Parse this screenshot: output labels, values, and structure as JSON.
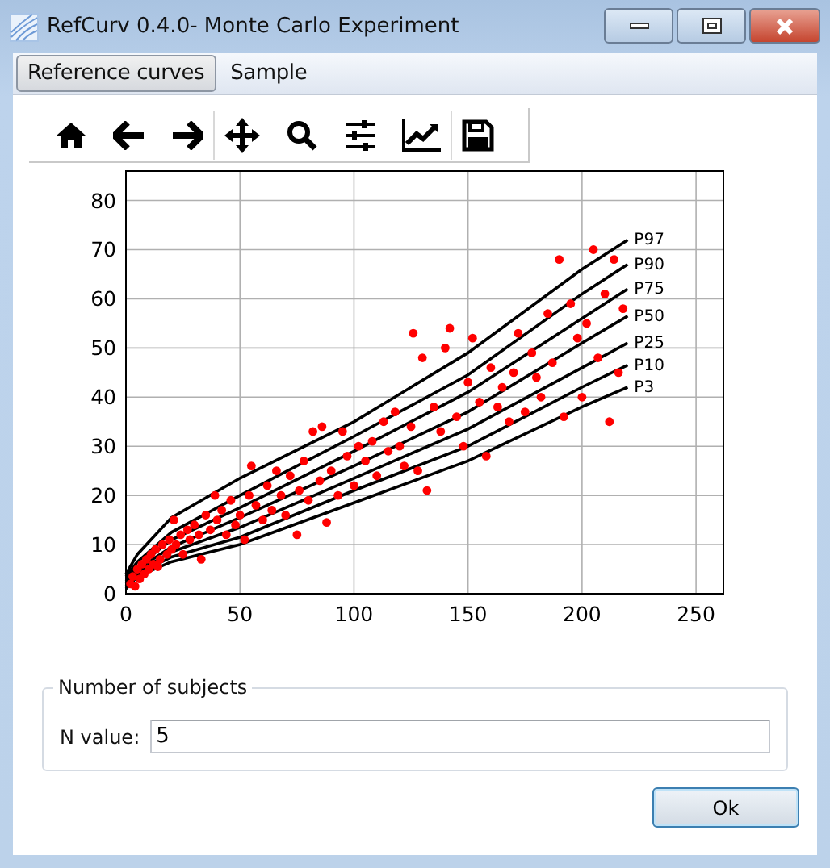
{
  "window": {
    "title": "RefCurv 0.4.0- Monte Carlo Experiment"
  },
  "tabs": [
    {
      "label": "Reference curves",
      "selected": true
    },
    {
      "label": "Sample",
      "selected": false
    }
  ],
  "plot": {
    "chart_data": {
      "type": "line",
      "grid": true,
      "xlim": [
        0,
        262
      ],
      "ylim": [
        0,
        86
      ],
      "xticks": [
        0,
        50,
        100,
        150,
        200,
        250
      ],
      "yticks": [
        0,
        10,
        20,
        30,
        40,
        50,
        60,
        70,
        80
      ],
      "x": [
        0,
        5,
        20,
        50,
        100,
        150,
        200,
        220
      ],
      "series": [
        {
          "name": "P97",
          "color": "#000000",
          "values": [
            4,
            8,
            15.5,
            23.5,
            35,
            49,
            66,
            72
          ]
        },
        {
          "name": "P90",
          "color": "#000000",
          "values": [
            3.5,
            6.5,
            12.5,
            20,
            32,
            44.5,
            61,
            67
          ]
        },
        {
          "name": "P75",
          "color": "#000000",
          "values": [
            3,
            5.5,
            11,
            17.5,
            29,
            41,
            56,
            62
          ]
        },
        {
          "name": "P50",
          "color": "#000000",
          "values": [
            2.5,
            5,
            9.5,
            15.5,
            26,
            37,
            51,
            56.5
          ]
        },
        {
          "name": "P25",
          "color": "#000000",
          "values": [
            2,
            4.5,
            8.5,
            13.5,
            23.5,
            33.5,
            46,
            51
          ]
        },
        {
          "name": "P10",
          "color": "#000000",
          "values": [
            1.5,
            4,
            7.5,
            11.5,
            21,
            30,
            42,
            46.5
          ]
        },
        {
          "name": "P3",
          "color": "#000000",
          "values": [
            1,
            3.5,
            6.5,
            10,
            18.5,
            27,
            38,
            42
          ]
        },
        {
          "color": "#ff0000",
          "type": "scatter",
          "x": [
            2,
            3,
            4,
            5,
            6,
            7,
            8,
            9,
            10,
            11,
            12,
            13,
            14,
            15,
            16,
            18,
            19,
            20,
            21,
            22,
            24,
            25,
            27,
            28,
            30,
            32,
            33,
            35,
            37,
            39,
            40,
            42,
            44,
            46,
            48,
            50,
            52,
            54,
            55,
            57,
            60,
            62,
            64,
            66,
            68,
            70,
            72,
            75,
            76,
            78,
            80,
            82,
            85,
            86,
            88,
            90,
            93,
            95,
            97,
            100,
            102,
            105,
            108,
            110,
            113,
            115,
            118,
            120,
            122,
            125,
            126,
            128,
            130,
            132,
            135,
            138,
            140,
            142,
            145,
            148,
            150,
            152,
            155,
            158,
            160,
            163,
            165,
            168,
            170,
            172,
            175,
            178,
            180,
            182,
            185,
            187,
            190,
            192,
            195,
            198,
            200,
            202,
            205,
            207,
            210,
            212,
            214,
            216,
            218
          ],
          "values": [
            2,
            3.5,
            1.5,
            5,
            3,
            6,
            4,
            7,
            5,
            8,
            6,
            9,
            5.5,
            7,
            10,
            8,
            11,
            9,
            15,
            10,
            12,
            8,
            13,
            11,
            14,
            12,
            7,
            16,
            13,
            20,
            15,
            17,
            12,
            19,
            14,
            16,
            11,
            20,
            26,
            18,
            15,
            22,
            17,
            25,
            20,
            16,
            24,
            12,
            21,
            27,
            19,
            33,
            23,
            34,
            14.5,
            25,
            20,
            33,
            28,
            22,
            30,
            27,
            31,
            24,
            35,
            29,
            37,
            30,
            26,
            34,
            53,
            25,
            48,
            21,
            38,
            33,
            50,
            54,
            36,
            30,
            43,
            52,
            39,
            28,
            46,
            38,
            42,
            35,
            45,
            53,
            37,
            49,
            44,
            40,
            57,
            47,
            68,
            36,
            59,
            52,
            40,
            55,
            70,
            48,
            61,
            35,
            68,
            45,
            58
          ]
        }
      ]
    }
  },
  "subjects": {
    "title": "Number of subjects",
    "label": "N value:",
    "value": "5"
  },
  "buttons": [
    "Ok"
  ]
}
